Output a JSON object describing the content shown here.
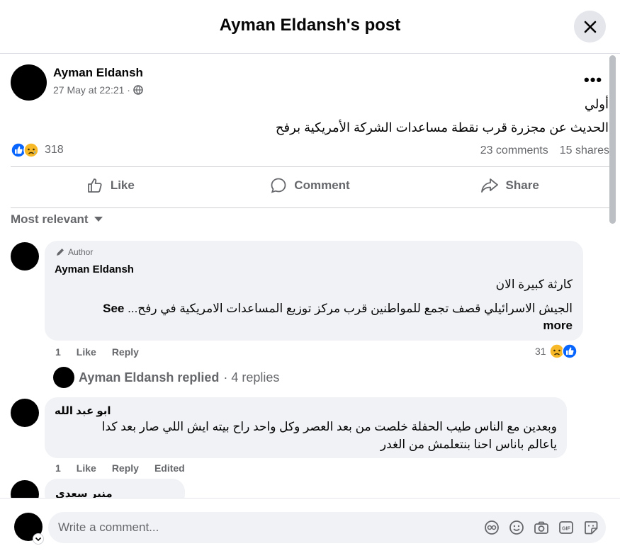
{
  "header": {
    "title": "Ayman Eldansh's post"
  },
  "post": {
    "author": "Ayman Eldansh",
    "time": "27 May at 22:21 ·",
    "lines": [
      "أولي",
      "الحديث عن مجزرة قرب نقطة مساعدات الشركة الأمريكية برفح"
    ],
    "reaction_count": "318",
    "comments": "23 comments",
    "shares": "15 shares"
  },
  "actions": {
    "like": "Like",
    "comment": "Comment",
    "share": "Share"
  },
  "sort_label": "Most relevant",
  "comments": [
    {
      "badge": "Author",
      "name": "Ayman Eldansh",
      "line1": "كارثة كبيرة الان",
      "line2": "الجيش الاسرائيلي قصف تجمع للمواطنين قرب مركز توزيع المساعدات الامريكية في رفح...",
      "see": "See",
      "more": "more",
      "time": "1",
      "like": "Like",
      "reply": "Reply",
      "reacts": "31"
    },
    {
      "name": "ابو عبد الله",
      "line1": "وبعدين مع الناس طيب الحفلة خلصت من بعد العصر وكل واحد راح بيته ايش اللي صار بعد كدا",
      "line2": "ياعالم باناس احنا بنتعلمش من الغدر",
      "time": "1",
      "like": "Like",
      "reply": "Reply",
      "edited": "Edited"
    },
    {
      "name": "منير سعدي"
    }
  ],
  "replies": {
    "name": "Ayman Eldansh replied",
    "count": "· 4 replies"
  },
  "composer": {
    "placeholder": "Write a comment..."
  },
  "icons": [
    "avatar-icon",
    "emoji-icon",
    "camera-icon",
    "gif-icon",
    "sticker-icon"
  ],
  "colors": {
    "accent": "#0866ff",
    "bubble": "#f0f2f5",
    "muted": "#65676b"
  }
}
